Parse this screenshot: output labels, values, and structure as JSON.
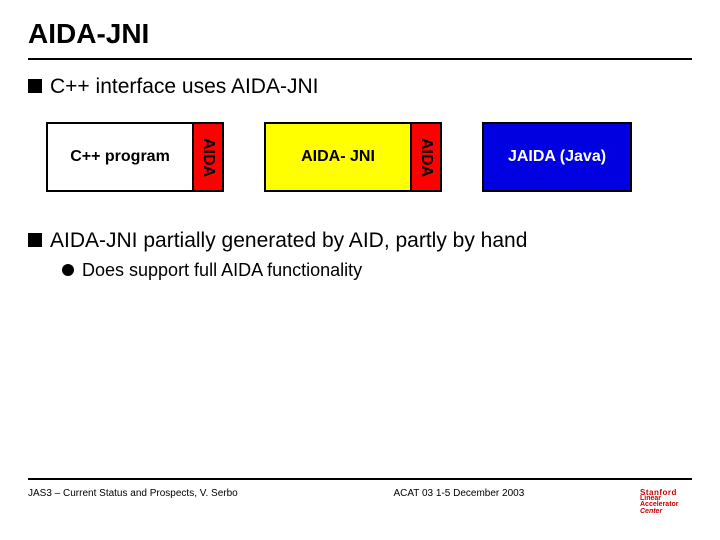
{
  "title": "AIDA-JNI",
  "bullets": {
    "b1": "C++ interface uses AIDA-JNI",
    "b2": "AIDA-JNI partially generated by AID, partly by hand",
    "b2_sub1": "Does support full AIDA functionality"
  },
  "diagram": {
    "box1_label": "C++ program",
    "aida_tab": "AIDA",
    "box2_label": "AIDA- JNI",
    "box3_label": "JAIDA (Java)"
  },
  "footer": {
    "left": "JAS3 – Current Status and Prospects,  V. Serbo",
    "mid": "ACAT 03    1-5 December 2003",
    "logo": {
      "l1": "Stanford",
      "l2": "Linear",
      "l3": "Accelerator",
      "l4": "Center"
    }
  }
}
